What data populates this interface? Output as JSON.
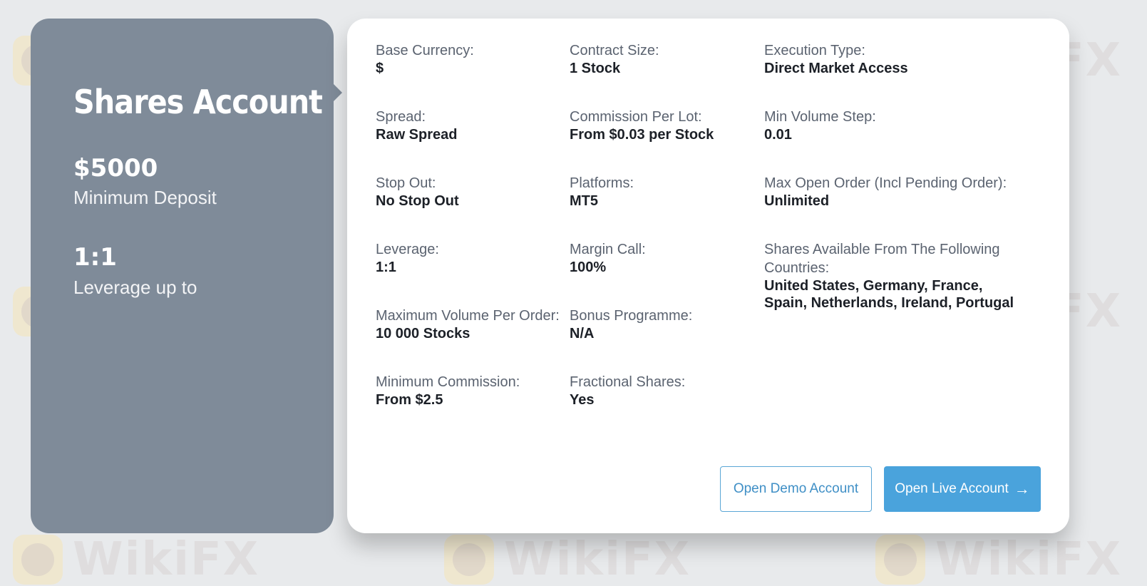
{
  "watermark": {
    "text": "WikiFX"
  },
  "account": {
    "title": "Shares Account",
    "minimum_deposit": {
      "value": "$5000",
      "label": "Minimum Deposit"
    },
    "leverage": {
      "value": "1:1",
      "label": "Leverage up to"
    }
  },
  "details": {
    "base_currency": {
      "label": "Base Currency:",
      "value": "$"
    },
    "contract_size": {
      "label": "Contract Size:",
      "value": "1 Stock"
    },
    "execution_type": {
      "label": "Execution Type:",
      "value": "Direct Market Access"
    },
    "spread": {
      "label": "Spread:",
      "value": "Raw Spread"
    },
    "commission_per_lot": {
      "label": "Commission Per Lot:",
      "value": "From $0.03 per Stock"
    },
    "min_volume_step": {
      "label": "Min Volume Step:",
      "value": "0.01"
    },
    "stop_out": {
      "label": "Stop Out:",
      "value": "No Stop Out"
    },
    "platforms": {
      "label": "Platforms:",
      "value": "MT5"
    },
    "max_open_order": {
      "label": "Max Open Order (Incl Pending Order):",
      "value": "Unlimited"
    },
    "leverage": {
      "label": "Leverage:",
      "value": "1:1"
    },
    "margin_call": {
      "label": "Margin Call:",
      "value": "100%"
    },
    "shares_countries": {
      "label": "Shares Available From The Following Countries:",
      "value": "United States, Germany, France, Spain, Netherlands, Ireland, Portugal"
    },
    "max_volume_per_order": {
      "label": "Maximum Volume Per Order:",
      "value": "10 000 Stocks"
    },
    "bonus_programme": {
      "label": "Bonus Programme:",
      "value": "N/A"
    },
    "minimum_commission": {
      "label": "Minimum Commission:",
      "value": "From $2.5"
    },
    "fractional_shares": {
      "label": "Fractional Shares:",
      "value": "Yes"
    }
  },
  "buttons": {
    "demo_label": "Open Demo Account",
    "live_label": "Open Live Account",
    "live_icon": "arrow-right-icon",
    "live_icon_glyph": "→"
  },
  "colors": {
    "left_card": "#7f8b99",
    "accent": "#4aa3dc",
    "background": "#e8eaec"
  }
}
